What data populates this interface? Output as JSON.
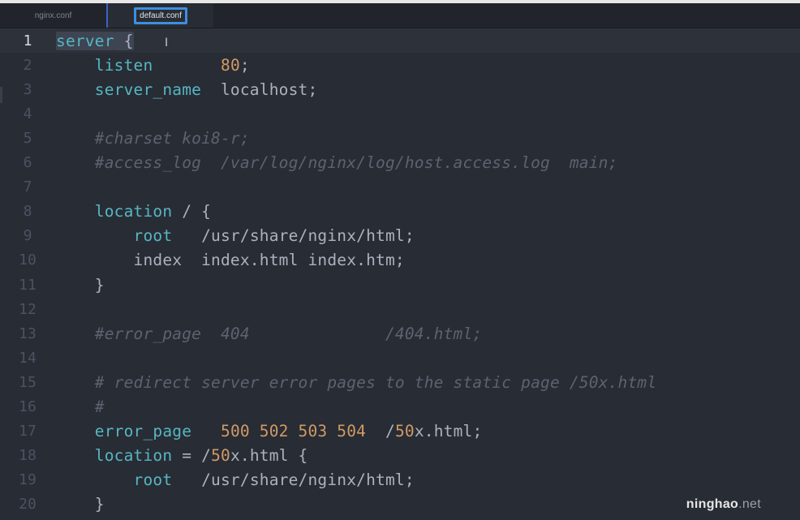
{
  "tabs": [
    {
      "label": "nginx.conf",
      "active": false
    },
    {
      "label": "default.conf",
      "active": true
    }
  ],
  "colors": {
    "keyword": "#56b6c2",
    "number": "#d19a66",
    "comment": "#5c6370",
    "text": "#abb2bf",
    "background": "#282c34",
    "active_tab_border": "#3d8fe0"
  },
  "editor": {
    "current_line": 1,
    "lines": [
      {
        "n": "1",
        "tokens": [
          {
            "t": "server",
            "c": "kw hl"
          },
          {
            "t": " {",
            "c": "plain hl"
          }
        ]
      },
      {
        "n": "2",
        "tokens": [
          {
            "t": "    "
          },
          {
            "t": "listen",
            "c": "kw"
          },
          {
            "t": "       "
          },
          {
            "t": "80",
            "c": "num"
          },
          {
            "t": ";",
            "c": "plain"
          }
        ]
      },
      {
        "n": "3",
        "tokens": [
          {
            "t": "    "
          },
          {
            "t": "server_name",
            "c": "kw"
          },
          {
            "t": "  localhost;",
            "c": "plain"
          }
        ]
      },
      {
        "n": "4",
        "tokens": []
      },
      {
        "n": "5",
        "tokens": [
          {
            "t": "    "
          },
          {
            "t": "#charset koi8-r;",
            "c": "comment"
          }
        ]
      },
      {
        "n": "6",
        "tokens": [
          {
            "t": "    "
          },
          {
            "t": "#access_log  /var/log/nginx/log/host.access.log  main;",
            "c": "comment"
          }
        ]
      },
      {
        "n": "7",
        "tokens": []
      },
      {
        "n": "8",
        "tokens": [
          {
            "t": "    "
          },
          {
            "t": "location",
            "c": "kw"
          },
          {
            "t": " / {",
            "c": "plain"
          }
        ]
      },
      {
        "n": "9",
        "tokens": [
          {
            "t": "        "
          },
          {
            "t": "root",
            "c": "kw"
          },
          {
            "t": "   /usr/share/nginx/html;",
            "c": "plain"
          }
        ]
      },
      {
        "n": "10",
        "tokens": [
          {
            "t": "        "
          },
          {
            "t": "index  index.html index.htm;",
            "c": "plain"
          }
        ]
      },
      {
        "n": "11",
        "tokens": [
          {
            "t": "    }",
            "c": "plain"
          }
        ]
      },
      {
        "n": "12",
        "tokens": []
      },
      {
        "n": "13",
        "tokens": [
          {
            "t": "    "
          },
          {
            "t": "#error_page  404              /404.html;",
            "c": "comment"
          }
        ]
      },
      {
        "n": "14",
        "tokens": []
      },
      {
        "n": "15",
        "tokens": [
          {
            "t": "    "
          },
          {
            "t": "# redirect server error pages to the static page /50x.html",
            "c": "comment"
          }
        ]
      },
      {
        "n": "16",
        "tokens": [
          {
            "t": "    "
          },
          {
            "t": "#",
            "c": "comment"
          }
        ]
      },
      {
        "n": "17",
        "tokens": [
          {
            "t": "    "
          },
          {
            "t": "error_page",
            "c": "kw"
          },
          {
            "t": "   "
          },
          {
            "t": "500 502 503 504",
            "c": "num"
          },
          {
            "t": "  /",
            "c": "plain"
          },
          {
            "t": "50",
            "c": "num"
          },
          {
            "t": "x.html;",
            "c": "plain"
          }
        ]
      },
      {
        "n": "18",
        "tokens": [
          {
            "t": "    "
          },
          {
            "t": "location",
            "c": "kw"
          },
          {
            "t": " = /",
            "c": "plain"
          },
          {
            "t": "50",
            "c": "num"
          },
          {
            "t": "x.html {",
            "c": "plain"
          }
        ]
      },
      {
        "n": "19",
        "tokens": [
          {
            "t": "        "
          },
          {
            "t": "root",
            "c": "kw"
          },
          {
            "t": "   /usr/share/nginx/html;",
            "c": "plain"
          }
        ]
      },
      {
        "n": "20",
        "tokens": [
          {
            "t": "    }",
            "c": "plain"
          }
        ]
      }
    ]
  },
  "watermark": {
    "brand": "ninghao",
    "suffix": ".net"
  }
}
